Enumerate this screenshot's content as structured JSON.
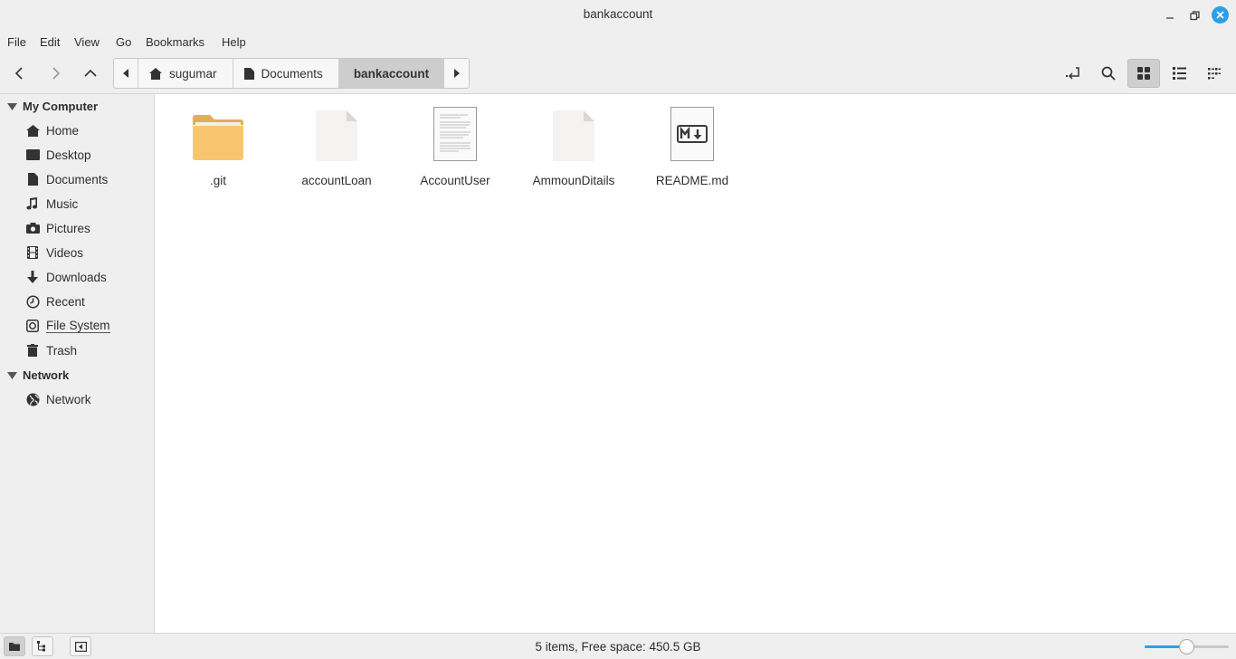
{
  "window": {
    "title": "bankaccount"
  },
  "menu": {
    "file": "File",
    "edit": "Edit",
    "view": "View",
    "go": "Go",
    "bookmarks": "Bookmarks",
    "help": "Help"
  },
  "path": {
    "crumbs": [
      "sugumar",
      "Documents",
      "bankaccount"
    ]
  },
  "sidebar": {
    "my_computer": "My Computer",
    "items": [
      "Home",
      "Desktop",
      "Documents",
      "Music",
      "Pictures",
      "Videos",
      "Downloads",
      "Recent",
      "File System",
      "Trash"
    ],
    "network_header": "Network",
    "network_items": [
      "Network"
    ]
  },
  "files": [
    {
      "name": ".git",
      "icon": "folder-icon"
    },
    {
      "name": "accountLoan",
      "icon": "blank-file-icon"
    },
    {
      "name": "AccountUser",
      "icon": "text-document-icon"
    },
    {
      "name": "AmmounDitails",
      "icon": "blank-file-icon"
    },
    {
      "name": "README.md",
      "icon": "markdown-file-icon"
    }
  ],
  "status": {
    "text": "5 items, Free space: 450.5 GB",
    "zoom_fraction": 0.5
  },
  "colors": {
    "accent": "#2e9fe6",
    "folder": "#f8c66e"
  }
}
